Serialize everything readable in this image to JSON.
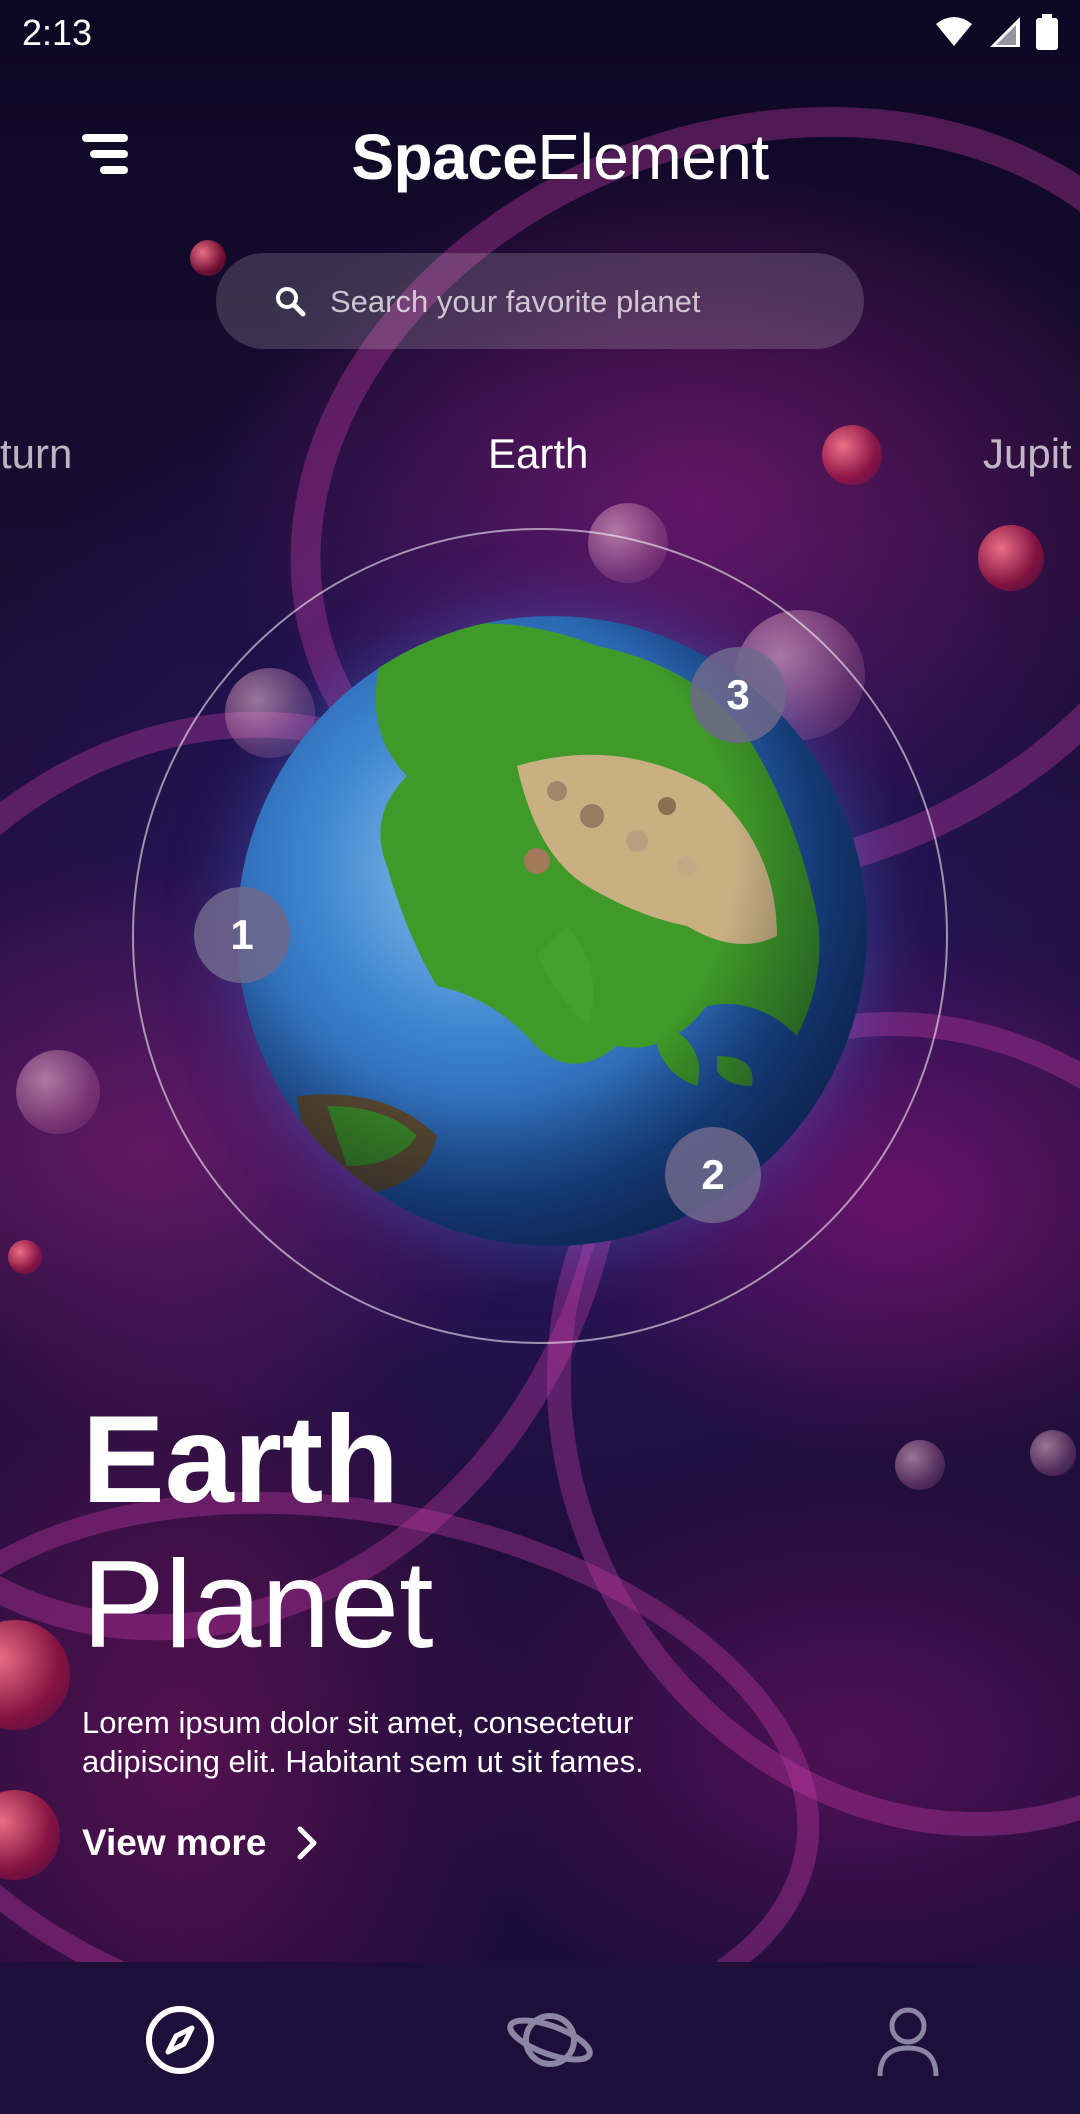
{
  "status_bar": {
    "time": "2:13"
  },
  "header": {
    "title_bold": "Space",
    "title_regular": "Element"
  },
  "search": {
    "placeholder": "Search your favorite planet"
  },
  "planet_tabs": [
    {
      "label": "turn"
    },
    {
      "label": "Earth"
    },
    {
      "label": "Jupit"
    }
  ],
  "hotspots": [
    "1",
    "2",
    "3"
  ],
  "hero": {
    "title_bold": "Earth",
    "title_regular": "Planet",
    "description": "Lorem ipsum dolor sit amet, consectetur adipiscing elit. Habitant sem ut sit fames.",
    "view_more": "View more"
  },
  "bottom_nav": {
    "items": [
      "compass-icon",
      "planet-icon",
      "profile-icon"
    ],
    "active": "compass-icon"
  },
  "colors": {
    "background": "#0b0620",
    "nav_background": "#1e0f3a",
    "hotspot": "#6e698c",
    "nav_inactive": "#8a86a3"
  }
}
